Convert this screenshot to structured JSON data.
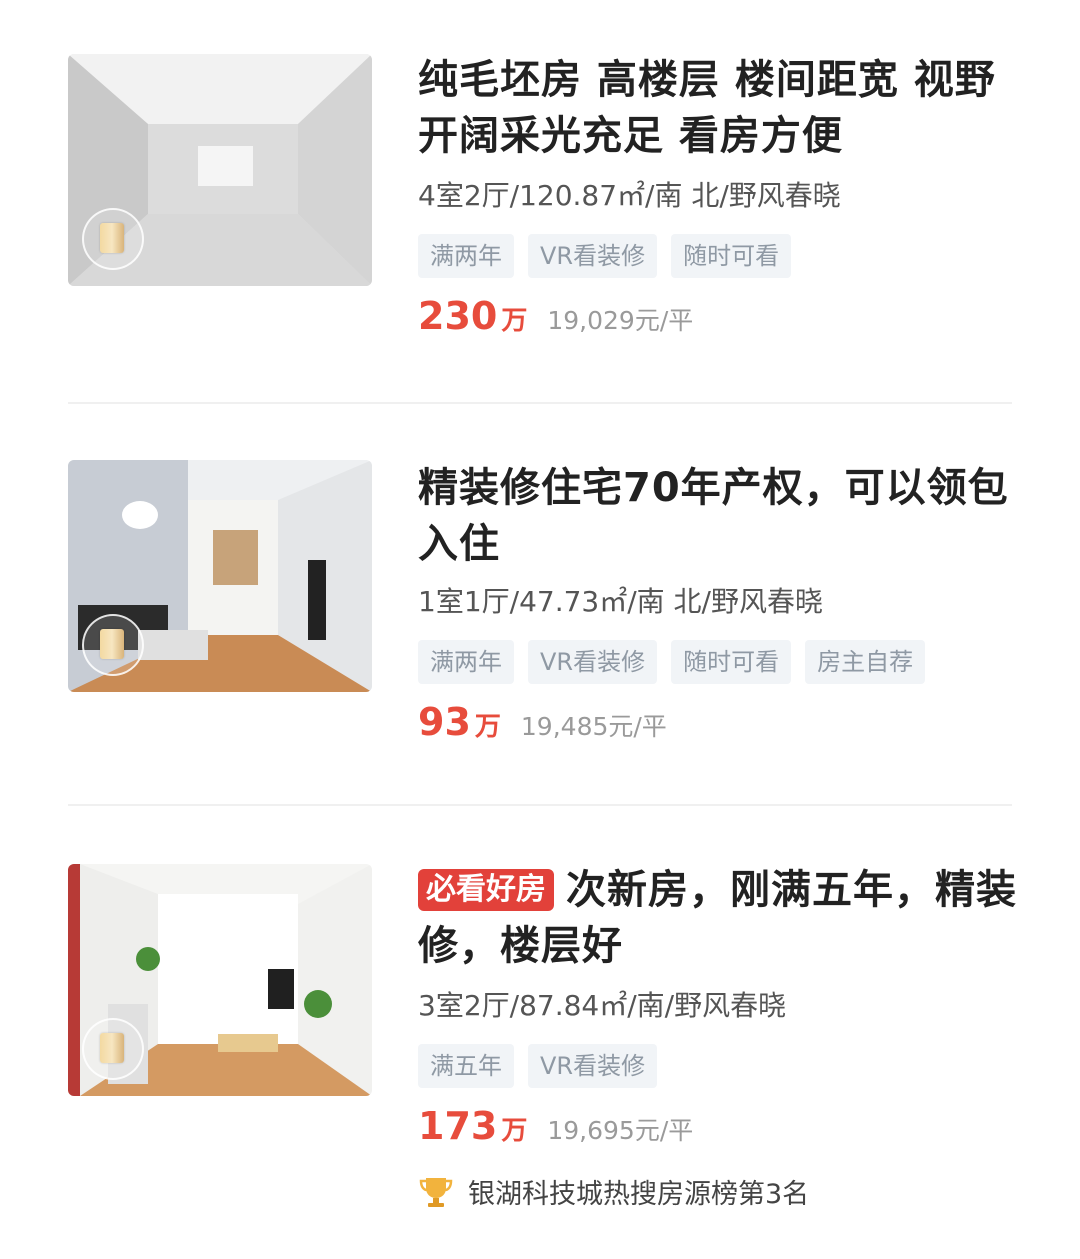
{
  "listings": [
    {
      "title": "纯毛坯房 高楼层 楼间距宽 视野开阔采光充足 看房方便",
      "hot_tag": "",
      "info": "4室2厅/120.87㎡/南 北/野风春晓",
      "tags": [
        "满两年",
        "VR看装修",
        "随时可看"
      ],
      "price": "230",
      "price_unit": "万",
      "unit_price": "19,029元/平",
      "thumb_icon": "vr-3d-icon"
    },
    {
      "title": "精装修住宅70年产权，可以领包入住",
      "hot_tag": "",
      "info": "1室1厅/47.73㎡/南 北/野风春晓",
      "tags": [
        "满两年",
        "VR看装修",
        "随时可看",
        "房主自荐"
      ],
      "price": "93",
      "price_unit": "万",
      "unit_price": "19,485元/平",
      "thumb_icon": "vr-3d-icon"
    },
    {
      "title": "次新房，刚满五年，精装修，楼层好",
      "hot_tag": "必看好房",
      "info": "3室2厅/87.84㎡/南/野风春晓",
      "tags": [
        "满五年",
        "VR看装修"
      ],
      "price": "173",
      "price_unit": "万",
      "unit_price": "19,695元/平",
      "thumb_icon": "vr-3d-icon",
      "rank_text": "银湖科技城热搜房源榜第3名"
    }
  ],
  "colors": {
    "price": "#e74c3c",
    "hot_tag_bg": "#e2413a",
    "tag_bg": "#f1f4f7",
    "tag_text": "#8f99a4"
  }
}
